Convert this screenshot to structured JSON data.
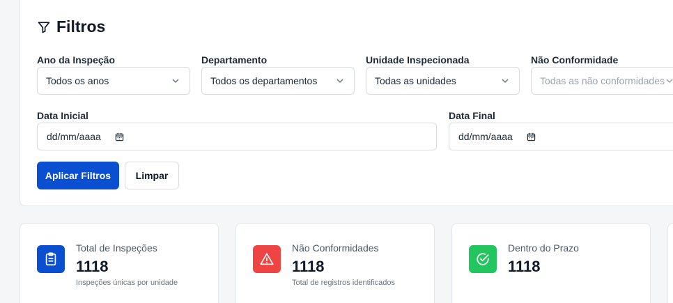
{
  "filters": {
    "title": "Filtros",
    "year": {
      "label": "Ano da Inspeção",
      "value": "Todos os anos"
    },
    "department": {
      "label": "Departamento",
      "value": "Todos os departamentos"
    },
    "unit": {
      "label": "Unidade Inspecionada",
      "value": "Todas as unidades"
    },
    "nonconformity": {
      "label": "Não Conformidade",
      "value": "Todas as não conformidades"
    },
    "start_date": {
      "label": "Data Inicial",
      "value": "dd/mm/aaaa"
    },
    "end_date": {
      "label": "Data Final",
      "value": "dd/mm/aaaa"
    },
    "apply_label": "Aplicar Filtros",
    "clear_label": "Limpar"
  },
  "stats": [
    {
      "label": "Total de Inspeções",
      "value": "1118",
      "sub": "Inspeções únicas por unidade",
      "icon": "clipboard-icon",
      "color": "#0b4fd1"
    },
    {
      "label": "Não Conformidades",
      "value": "1118",
      "sub": "Total de registros identificados",
      "icon": "warning-icon",
      "color": "#ef4444"
    },
    {
      "label": "Dentro do Prazo",
      "value": "1118",
      "sub": "",
      "icon": "check-circle-icon",
      "color": "#22c55e"
    }
  ]
}
